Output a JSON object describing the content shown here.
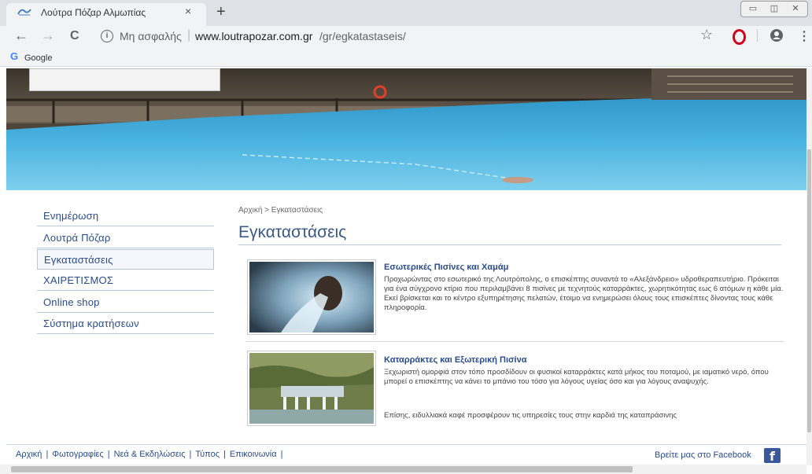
{
  "browser": {
    "tab_title": "Λούτρα Πόζαρ Αλμωπίας",
    "tab_close": "×",
    "new_tab": "+",
    "window_controls": {
      "minimize": "▭",
      "maximize": "◫",
      "close": "✕"
    },
    "nav": {
      "back": "←",
      "forward": "→",
      "reload": "C"
    },
    "address": {
      "info": "i",
      "security_label": "Μη ασφαλής",
      "separator": "|",
      "host": "www.loutrapozar.com.gr",
      "path": "/gr/egkatastaseis/"
    },
    "star": "☆",
    "menu": "⋮",
    "bookmarks": [
      {
        "icon": "G",
        "label": "Google"
      }
    ],
    "brand_colors": {
      "opera": "#d0021b",
      "google": "#4285f4"
    }
  },
  "sidebar": {
    "items": [
      {
        "label": "Ενημέρωση",
        "active": false
      },
      {
        "label": "Λουτρά Πόζαρ",
        "active": false
      },
      {
        "label": "Εγκαταστάσεις",
        "active": true
      },
      {
        "label": "ΧΑΙΡΕΤΙΣΜΟΣ",
        "active": false
      },
      {
        "label": "Online shop",
        "active": false
      },
      {
        "label": "Σύστημα κρατήσεων",
        "active": false
      }
    ]
  },
  "main": {
    "breadcrumb": "Αρχική > Εγκαταστάσεις",
    "title": "Εγκαταστάσεις",
    "items": [
      {
        "title": "Εσωτερικές Πισίνες και Χαμάμ",
        "text": "Προχωρώντας στο εσωτερικό της Λουτρόπολης, ο επισκέπτης συναντά το «Αλεξάνδρειο» υδροθεραπευτήριο. Πρόκειται για ένα σύγχρονο κτίριο που περιλαμβάνει 8 πισίνες με τεχνητούς καταρράκτες, χωρητικότητας εως 6 ατόμων η κάθε μία. Εκεί βρίσκεται και το κέντρο εξυπηρέτησης πελατών, έτοιμο να ενημερώσει όλους τους επισκέπτες δίνοντας τους κάθε πληροφορία."
      },
      {
        "title": "Καταρράκτες και Εξωτερική Πισίνα",
        "text": "Ξεχωριστή ομορφιά στον τόπο προσδίδουν οι φυσικοί καταρράκτες κατά μήκος του ποταμού, με ιαματικό νερό, όπου μπορεί ο επισκέπτης να κάνει το μπάνιο του τόσο για λόγους υγείας όσο και για λόγους αναψυχής.",
        "text2": "Επίσης, ειδυλλιακά καφέ προσφέρουν τις υπηρεσίες τους στην καρδιά της καταπράσινης"
      }
    ]
  },
  "footer": {
    "links": [
      "Αρχική",
      "Φωτογραφίες",
      "Νεά & Εκδηλώσεις",
      "Τύπος",
      "Επικοινωνία"
    ],
    "separator": "|",
    "facebook_text": "Βρείτε μας στο Facebook",
    "facebook_icon": "f",
    "facebook_color": "#3b5998"
  }
}
